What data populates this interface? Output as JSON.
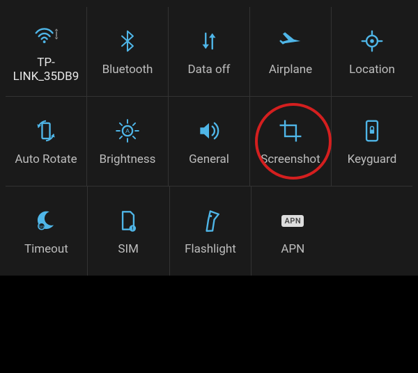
{
  "accent_color": "#4fb6e8",
  "highlight_color": "#d41f1f",
  "tiles": {
    "wifi": {
      "label": "TP-LINK_35DB9",
      "icon": "wifi-icon"
    },
    "bluetooth": {
      "label": "Bluetooth",
      "icon": "bluetooth-icon"
    },
    "data": {
      "label": "Data off",
      "icon": "data-swap-icon"
    },
    "airplane": {
      "label": "Airplane",
      "icon": "airplane-icon"
    },
    "location": {
      "label": "Location",
      "icon": "location-icon"
    },
    "rotate": {
      "label": "Auto Rotate",
      "icon": "rotate-icon"
    },
    "brightness": {
      "label": "Brightness",
      "icon": "brightness-icon"
    },
    "sound": {
      "label": "General",
      "icon": "volume-icon"
    },
    "screenshot": {
      "label": "Screenshot",
      "icon": "crop-icon"
    },
    "keyguard": {
      "label": "Keyguard",
      "icon": "lock-phone-icon"
    },
    "timeout": {
      "label": "Timeout",
      "icon": "moon-icon"
    },
    "sim": {
      "label": "SIM",
      "icon": "sim-icon"
    },
    "flashlight": {
      "label": "Flashlight",
      "icon": "flashlight-icon"
    },
    "apn": {
      "label": "APN",
      "icon": "apn-chip",
      "chip_text": "APN"
    }
  }
}
